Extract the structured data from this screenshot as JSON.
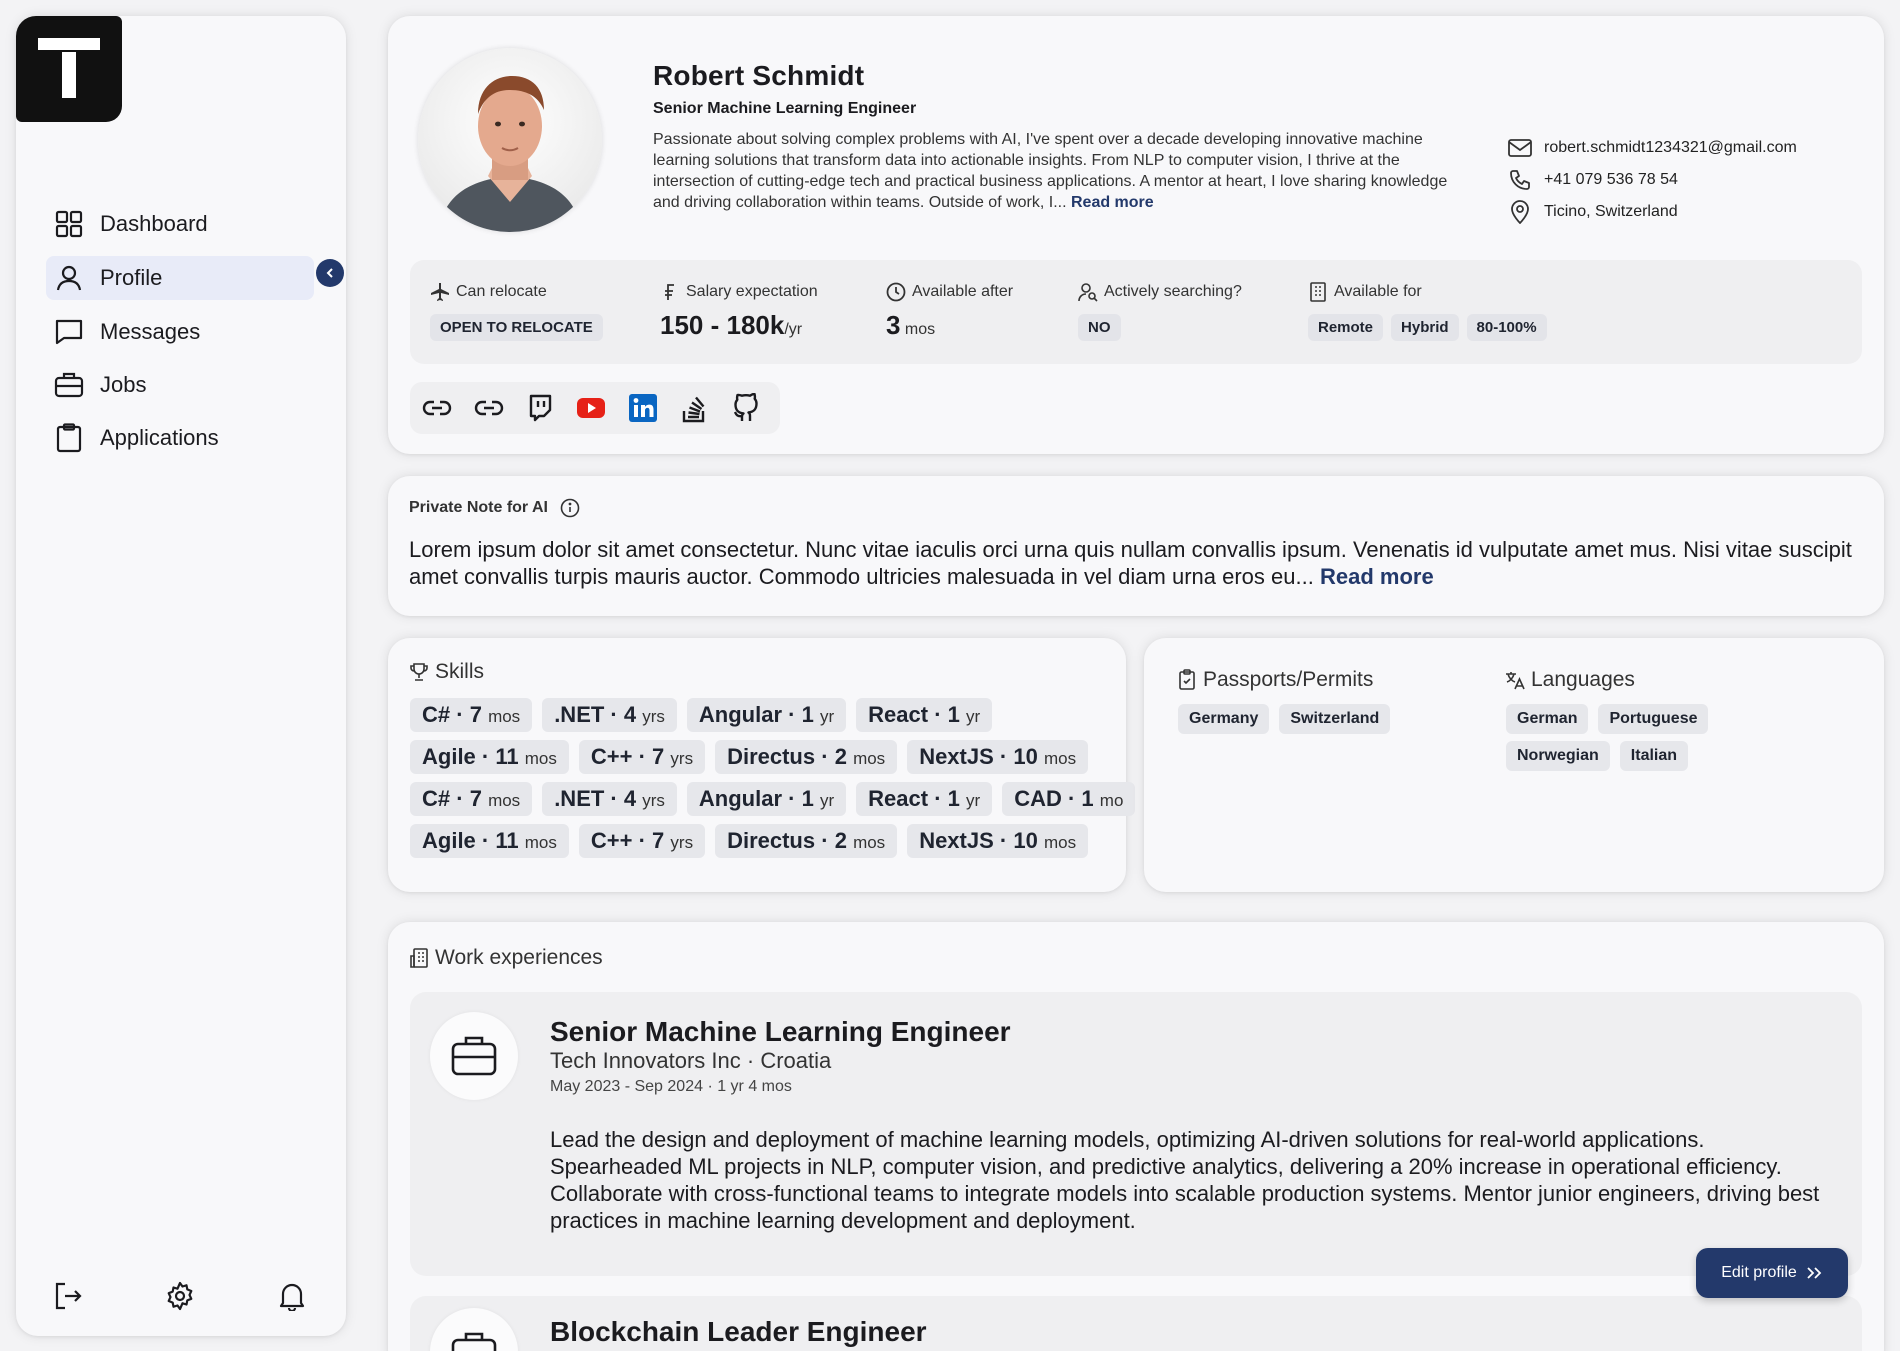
{
  "sidebar": {
    "items": [
      {
        "label": "Dashboard",
        "icon": "dashboard-icon"
      },
      {
        "label": "Profile",
        "icon": "user-icon",
        "active": true
      },
      {
        "label": "Messages",
        "icon": "message-icon"
      },
      {
        "label": "Jobs",
        "icon": "briefcase-icon"
      },
      {
        "label": "Applications",
        "icon": "clipboard-icon"
      }
    ],
    "bottom_icons": [
      "logout-icon",
      "gear-icon",
      "bell-icon"
    ]
  },
  "profile": {
    "name": "Robert Schmidt",
    "title": "Senior Machine Learning Engineer",
    "bio": "Passionate about solving complex problems with AI, I've spent over a decade developing innovative machine learning solutions that transform data into actionable insights. From NLP to computer vision, I thrive at the intersection of cutting-edge tech and practical business applications. A mentor at heart, I love sharing knowledge and driving collaboration within teams. Outside of work, I...",
    "read_more": "Read more",
    "email": "robert.schmidt1234321@gmail.com",
    "phone": "+41 079 536 78 54",
    "location": "Ticino, Switzerland"
  },
  "facts": {
    "relocate_label": "Can relocate",
    "relocate_value": "OPEN TO RELOCATE",
    "salary_label": "Salary expectation",
    "salary_value": "150 - 180k",
    "salary_unit": "/yr",
    "available_after_label": "Available after",
    "available_after_value": "3",
    "available_after_unit": "mos",
    "searching_label": "Actively searching?",
    "searching_value": "NO",
    "available_for_label": "Available for",
    "available_for_values": [
      "Remote",
      "Hybrid",
      "80-100%"
    ]
  },
  "socials": [
    "link-icon",
    "link-icon",
    "twitch-icon",
    "youtube-icon",
    "linkedin-icon",
    "stackoverflow-icon",
    "github-icon"
  ],
  "note": {
    "title": "Private Note for AI",
    "text": "Lorem ipsum dolor sit amet consectetur. Nunc vitae iaculis orci urna quis nullam convallis ipsum. Venenatis id vulputate amet mus. Nisi vitae suscipit amet convallis turpis mauris auctor. Commodo ultricies malesuada in vel diam urna eros eu...",
    "read_more": "Read more"
  },
  "skills": {
    "title": "Skills",
    "rows": [
      [
        {
          "name": "C#",
          "dur": "7",
          "unit": "mos"
        },
        {
          "name": ".NET",
          "dur": "4",
          "unit": "yrs"
        },
        {
          "name": "Angular",
          "dur": "1",
          "unit": "yr"
        },
        {
          "name": "React",
          "dur": "1",
          "unit": "yr"
        }
      ],
      [
        {
          "name": "Agile",
          "dur": "11",
          "unit": "mos"
        },
        {
          "name": "C++",
          "dur": "7",
          "unit": "yrs"
        },
        {
          "name": "Directus",
          "dur": "2",
          "unit": "mos"
        },
        {
          "name": "NextJS",
          "dur": "10",
          "unit": "mos"
        }
      ],
      [
        {
          "name": "C#",
          "dur": "7",
          "unit": "mos"
        },
        {
          "name": ".NET",
          "dur": "4",
          "unit": "yrs"
        },
        {
          "name": "Angular",
          "dur": "1",
          "unit": "yr"
        },
        {
          "name": "React",
          "dur": "1",
          "unit": "yr"
        },
        {
          "name": "CAD",
          "dur": "1",
          "unit": "mo"
        }
      ],
      [
        {
          "name": "Agile",
          "dur": "11",
          "unit": "mos"
        },
        {
          "name": "C++",
          "dur": "7",
          "unit": "yrs"
        },
        {
          "name": "Directus",
          "dur": "2",
          "unit": "mos"
        },
        {
          "name": "NextJS",
          "dur": "10",
          "unit": "mos"
        }
      ]
    ]
  },
  "permits": {
    "title": "Passports/Permits",
    "items": [
      "Germany",
      "Switzerland"
    ]
  },
  "languages": {
    "title": "Languages",
    "row1": [
      "German",
      "Portuguese"
    ],
    "row2": [
      "Norwegian",
      "Italian"
    ]
  },
  "work": {
    "title": "Work experiences",
    "items": [
      {
        "title": "Senior Machine Learning Engineer",
        "company": "Tech Innovators Inc · Croatia",
        "dates": "May 2023 - Sep 2024 · 1 yr 4 mos",
        "description": "Lead the design and deployment of machine learning models, optimizing AI-driven solutions for real-world applications. Spearheaded ML projects in NLP, computer vision, and predictive analytics, delivering a 20% increase in operational efficiency. Collaborate with cross-functional teams to integrate models into scalable production systems. Mentor junior engineers, driving best practices in machine learning development and deployment."
      },
      {
        "title": "Blockchain Leader Engineer"
      }
    ]
  },
  "edit_button": "Edit profile",
  "colors": {
    "accent": "#23396b",
    "active_nav": "#e8ebf8",
    "youtube": "#e62117",
    "linkedin": "#0a66c2"
  }
}
